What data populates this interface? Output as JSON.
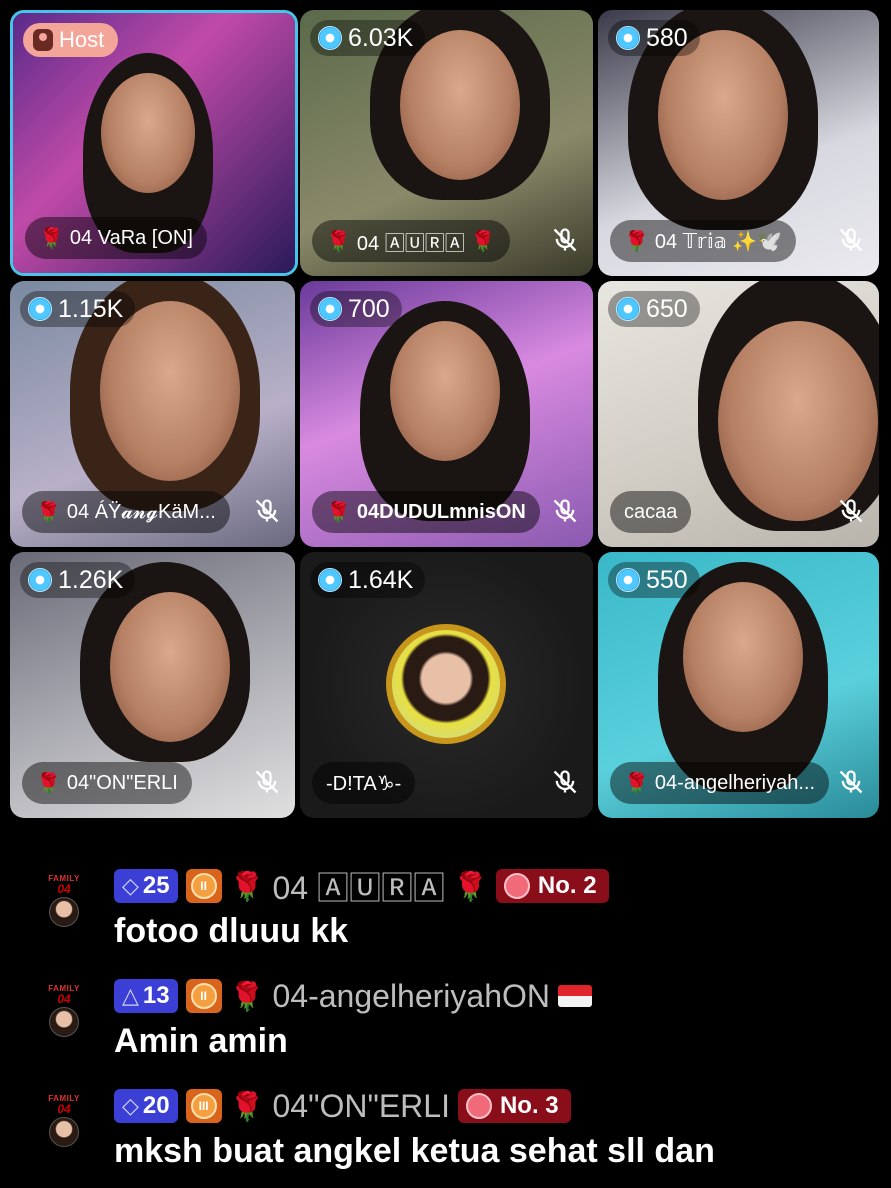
{
  "tiles": [
    {
      "id": "vara",
      "host": true,
      "badge": "Host",
      "name": "04 VaRa [ON]",
      "rose": true,
      "muted": false,
      "score": null
    },
    {
      "id": "aura",
      "host": false,
      "score": "6.03K",
      "name": "04 🄰🅄🅁🄰",
      "rose": true,
      "muted": true
    },
    {
      "id": "tria",
      "host": false,
      "score": "580",
      "name": "04 𝕋𝕣𝕚𝕒 ✨🕊️",
      "rose": true,
      "muted": true
    },
    {
      "id": "ayang",
      "host": false,
      "score": "1.15K",
      "name": "04 ÁŸ𝓪𝓷𝓰KäM...",
      "rose": true,
      "muted": true
    },
    {
      "id": "dudul",
      "host": false,
      "score": "700",
      "name": "04DUDULmnisON",
      "rose": true,
      "muted": true
    },
    {
      "id": "cacaa",
      "host": false,
      "score": "650",
      "name": "cacaa",
      "rose": false,
      "muted": true
    },
    {
      "id": "erli",
      "host": false,
      "score": "1.26K",
      "name": "04\"ON\"ERLI",
      "rose": true,
      "muted": true
    },
    {
      "id": "dita",
      "host": false,
      "score": "1.64K",
      "name": "-D!TA♑-",
      "rose": false,
      "muted": true
    },
    {
      "id": "angel",
      "host": false,
      "score": "550",
      "name": "04-angelheriyah...",
      "rose": true,
      "muted": true
    }
  ],
  "chat": [
    {
      "level": "25",
      "fan": "II",
      "user": "04 🄰🅄🅁🄰",
      "rank": "No. 2",
      "text": "fotoo dluuu kk",
      "flag": false
    },
    {
      "level": "13",
      "fan": "II",
      "user": "04-angelheriyahON",
      "rank": null,
      "text": "Amin amin",
      "flag": true
    },
    {
      "level": "20",
      "fan": "III",
      "user": "04\"ON\"ERLI",
      "rank": "No. 3",
      "text": "mksh buat angkel ketua sehat sll dan",
      "flag": false
    }
  ],
  "avatar_text": {
    "family": "FAMILY",
    "num": "04"
  },
  "colors": {
    "host_border": "#46c5e8",
    "host_badge": "#f4a59a",
    "level_badge": "#3b3fd6",
    "rank_badge": "#8a0e1a",
    "fan_badge": "#d9641c"
  }
}
